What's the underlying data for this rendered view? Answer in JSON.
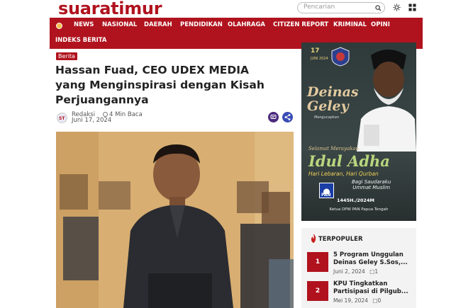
{
  "site": {
    "logo": "suaratimur"
  },
  "header": {
    "search_placeholder": "Pencarian",
    "theme_icon": "sun-icon",
    "apps_icon": "grid-icon"
  },
  "nav": {
    "items": [
      "NEWS",
      "NASIONAL",
      "DAERAH",
      "PENDIDIKAN",
      "OLAHRAGA",
      "CITIZEN REPORT",
      "KRIMINAL",
      "OPINI"
    ],
    "row2": "INDEKS BERITA"
  },
  "article": {
    "category": "Berita",
    "title": "Hassan Fuad, CEO UDEX MEDIA yang Menginspirasi dengan Kisah Perjuangannya",
    "author": "Redaksi",
    "read_time": "4 Min Baca",
    "date": "Juni 17, 2024"
  },
  "ad": {
    "date_big": "17",
    "date_sub": "JUNI 2024",
    "name_line1": "Deinas",
    "name_line2": "Geley",
    "mengucapkan": "Mengucapkan",
    "selamat": "Selamat Merayakan",
    "idul": "Idul Adha",
    "hari": "Hari Lebaran, Hari Qurban",
    "bagi1": "Bagi Saudaraku",
    "bagi2": "Ummat Muslim",
    "pan": "PAN",
    "year": "1445H./2024M",
    "ketua": "Ketua DPW PAN Papua Tengah"
  },
  "trending": {
    "heading": "TERPOPULER",
    "items": [
      {
        "num": "1",
        "title": "5 Program Unggulan Deinas Geley S.Sos,...",
        "date": "Juni 2, 2024",
        "comments": "1"
      },
      {
        "num": "2",
        "title": "KPU Tingkatkan Partisipasi di Pilgub...",
        "date": "Mei 19, 2024",
        "comments": "0"
      }
    ]
  },
  "colors": {
    "brand": "#b0131e",
    "nav": "#b0131e",
    "accent": "#4b2a7d"
  }
}
